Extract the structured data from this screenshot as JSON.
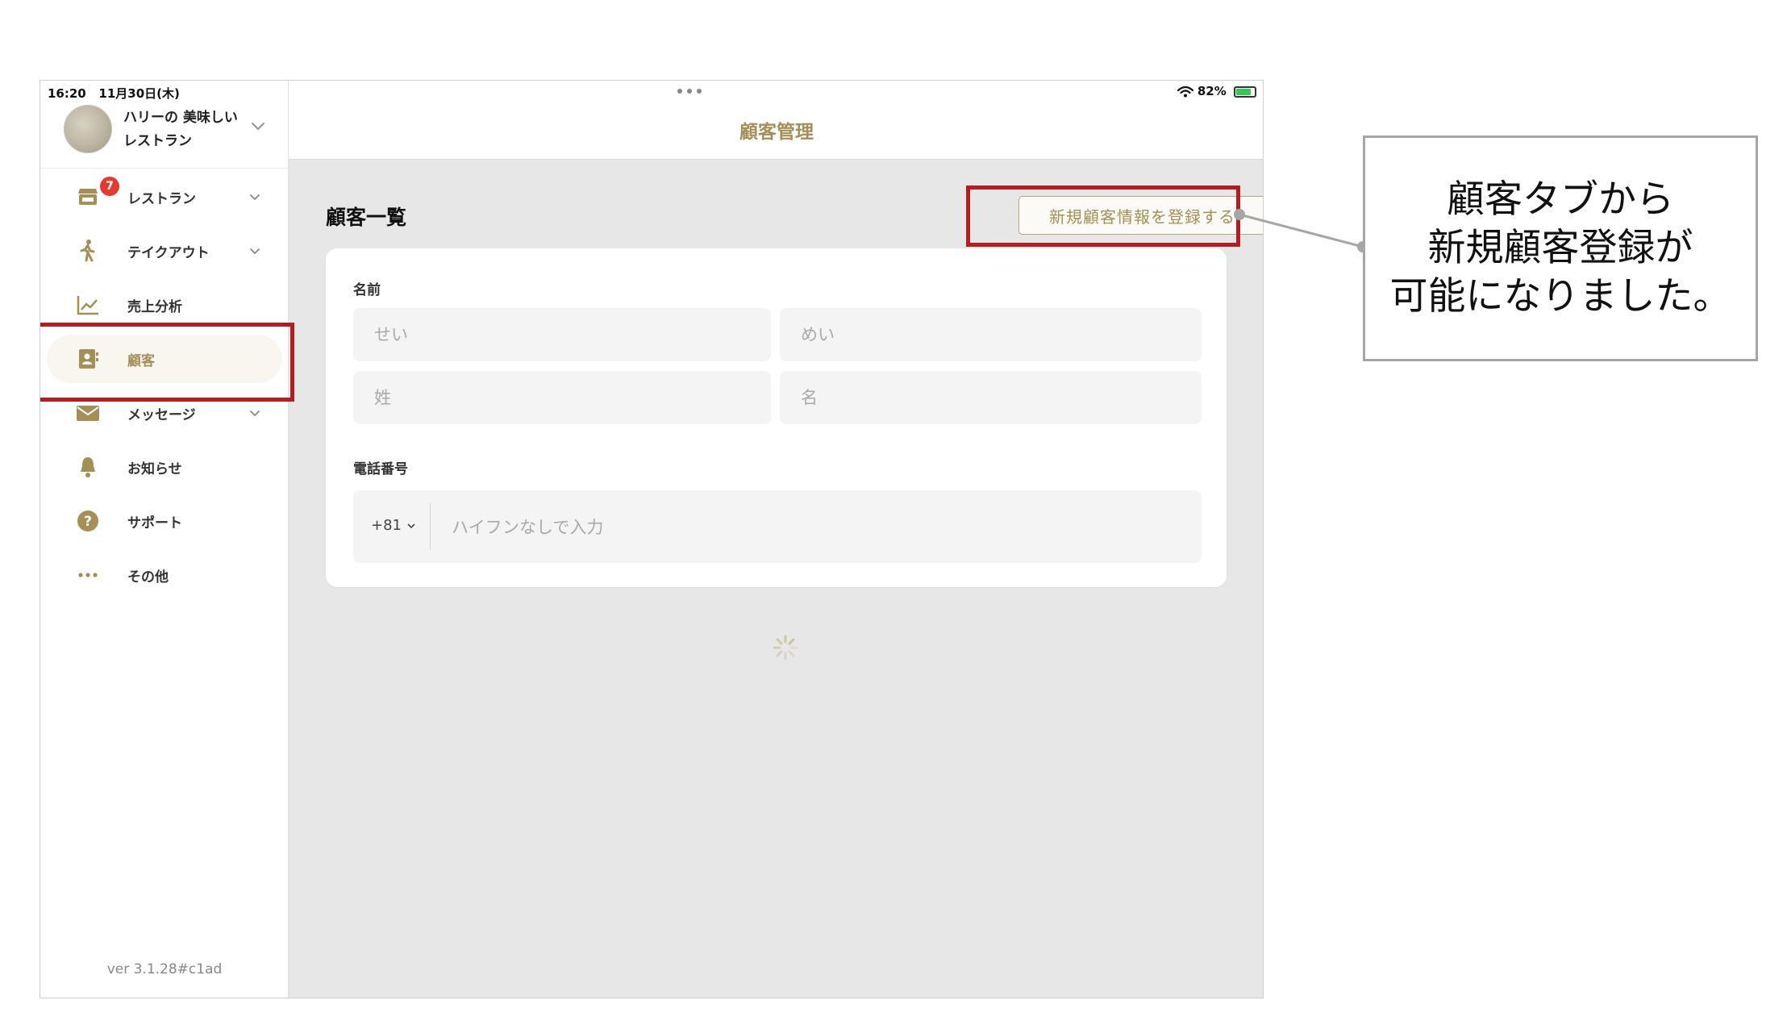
{
  "status_bar": {
    "time": "16:20",
    "date": "11月30日(木)",
    "battery_percent": "82%",
    "battery_level": 0.82
  },
  "sidebar": {
    "account": {
      "name": "ハリーの 美味しいレストラン"
    },
    "items": [
      {
        "label": "レストラン",
        "icon": "shop-icon",
        "badge": "7",
        "has_chevron": true
      },
      {
        "label": "テイクアウト",
        "icon": "walking-person-icon",
        "has_chevron": true
      },
      {
        "label": "売上分析",
        "icon": "line-chart-icon",
        "has_chevron": false
      },
      {
        "label": "顧客",
        "icon": "contact-book-icon",
        "active": true,
        "has_chevron": false
      },
      {
        "label": "メッセージ",
        "icon": "envelope-icon",
        "has_chevron": true
      },
      {
        "label": "お知らせ",
        "icon": "bell-icon",
        "has_chevron": false
      },
      {
        "label": "サポート",
        "icon": "question-circle-icon",
        "has_chevron": false
      },
      {
        "label": "その他",
        "icon": "more-dots-icon",
        "has_chevron": false
      }
    ],
    "version": "ver 3.1.28#c1ad"
  },
  "header": {
    "title": "顧客管理"
  },
  "main": {
    "heading": "顧客一覧",
    "register_button": "新規顧客情報を登録する",
    "form": {
      "name_label": "名前",
      "kana_last_placeholder": "せい",
      "kana_first_placeholder": "めい",
      "last_placeholder": "姓",
      "first_placeholder": "名",
      "phone_label": "電話番号",
      "country_code": "+81",
      "phone_placeholder": "ハイフンなしで入力"
    }
  },
  "annotation": {
    "lines": [
      "顧客タブから",
      "新規顧客登録が",
      "可能になりました。"
    ]
  },
  "colors": {
    "accent": "#a48f56",
    "highlight": "#b31e20",
    "badge": "#e23b2f",
    "content_bg": "#e7e7e7"
  }
}
